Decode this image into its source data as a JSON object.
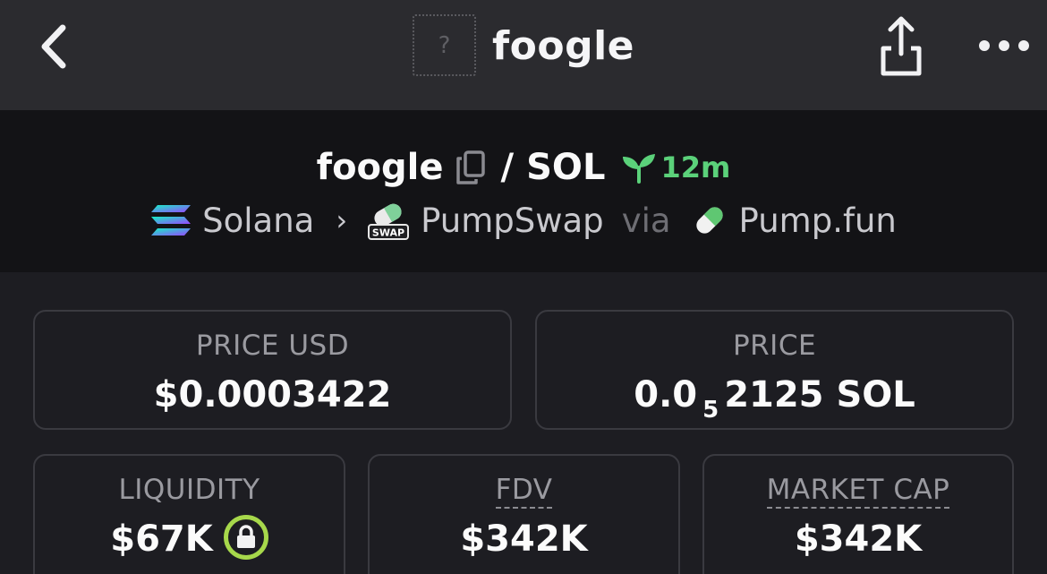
{
  "header": {
    "title": "foogle",
    "avatar_placeholder": "?"
  },
  "pair": {
    "base": "foogle",
    "separator": "/",
    "quote": "SOL",
    "age": "12m"
  },
  "chain": {
    "network": "Solana",
    "dex": "PumpSwap",
    "via": "via",
    "launchpad": "Pump.fun",
    "dex_badge": "SWAP"
  },
  "stats": {
    "price_usd": {
      "label": "PRICE USD",
      "value": "$0.0003422"
    },
    "price": {
      "label": "PRICE",
      "prefix": "0.0",
      "zeros": "5",
      "suffix": "2125 SOL"
    },
    "liquidity": {
      "label": "LIQUIDITY",
      "value": "$67K"
    },
    "fdv": {
      "label": "FDV",
      "value": "$342K"
    },
    "market_cap": {
      "label": "MARKET CAP",
      "value": "$342K"
    }
  },
  "colors": {
    "accent_green": "#5bd17a",
    "lock_ring": "#a7d84b",
    "card_border": "#3a3a40",
    "label_gray": "#9a9aa0"
  },
  "icons": {
    "back": "chevron-left-icon",
    "share": "share-icon",
    "more": "more-horizontal-icon",
    "copy": "copy-icon",
    "age": "seedling-icon",
    "network": "solana-logo-icon",
    "dex": "pumpswap-logo-icon",
    "launchpad": "pill-icon",
    "liquidity_lock": "lock-icon"
  }
}
